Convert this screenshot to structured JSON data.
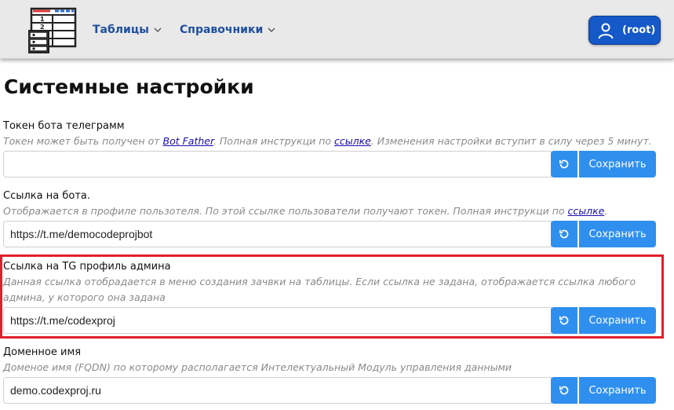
{
  "nav": {
    "tables": "Таблицы",
    "references": "Справочники",
    "user": "(root)"
  },
  "page": {
    "title": "Системные настройки"
  },
  "settings": [
    {
      "label": "Токен бота телеграмм",
      "hint_before": "Токен может быть получен от ",
      "hint_link1": "Bot Father",
      "hint_middle": ". Полная инструкци по ",
      "hint_link2": "ссылке",
      "hint_after": ". Изменения настройки вступит в силу через 5 минут.",
      "value": "",
      "save_label": "Сохранить"
    },
    {
      "label": "Ссылка на бота.",
      "hint_before": "Отображается в профиле пользотеля. По этой ссылке пользователи получают токен. Полная инструкци по ",
      "hint_link": "ссылке",
      "hint_after": ".",
      "value": "https://t.me/democodeprojbot",
      "save_label": "Сохранить"
    },
    {
      "label": "Ссылка на TG профиль админа",
      "hint": "Данная ссылка отобрадается в меню создания зачвки на таблицы. Если ссылка не задана, отображается ссылка любого админа, у которого она задана",
      "value": "https://t.me/codexproj",
      "save_label": "Сохранить"
    },
    {
      "label": "Доменное имя",
      "hint": "Доменое имя (FQDN) по которому располагается Интелектуальный Модуль управления данными",
      "value": "demo.codexproj.ru",
      "save_label": "Сохранить"
    }
  ],
  "colors": {
    "accent": "#2f8fef",
    "nav_text": "#1f4f9e",
    "user_button": "#1558c8",
    "highlight": "#e0202a"
  }
}
